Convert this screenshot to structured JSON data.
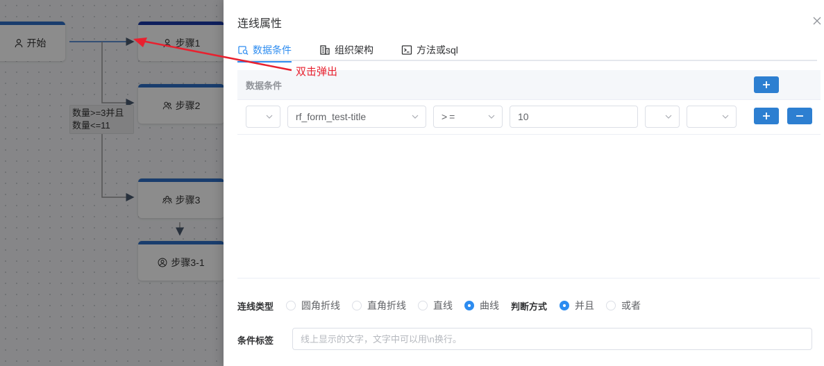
{
  "canvas": {
    "nodes": [
      {
        "label": "开始",
        "icon": "user-icon"
      },
      {
        "label": "步骤1",
        "icon": "user-icon"
      },
      {
        "label": "步骤2",
        "icon": "users-icon"
      },
      {
        "label": "步骤3",
        "icon": "group-icon"
      },
      {
        "label": "步骤3-1",
        "icon": "user-circle-icon"
      }
    ],
    "edge_label": "数量>=3并且\n数量<=11"
  },
  "annotation": "双击弹出",
  "drawer": {
    "title": "连线属性",
    "tabs": [
      {
        "label": "数据条件",
        "icon": "search-database-icon",
        "active": true
      },
      {
        "label": "组织架构",
        "icon": "building-icon",
        "active": false
      },
      {
        "label": "方法或sql",
        "icon": "terminal-icon",
        "active": false
      }
    ],
    "condition": {
      "header": "数据条件",
      "row": {
        "left_paren": "",
        "field": "rf_form_test-title",
        "operator": ">=",
        "value": "10",
        "right_paren": "",
        "logic": ""
      }
    },
    "line_type": {
      "label": "连线类型",
      "options": [
        "圆角折线",
        "直角折线",
        "直线",
        "曲线"
      ],
      "selected": "曲线"
    },
    "judge_mode": {
      "label": "判断方式",
      "options": [
        "并且",
        "或者"
      ],
      "selected": "并且"
    },
    "condition_label": {
      "label": "条件标签",
      "placeholder": "线上显示的文字，文字中可以用\\n换行。"
    }
  },
  "colors": {
    "accent": "#2d8cf0",
    "button": "#2d7fd1",
    "annotation": "#e8212f"
  }
}
